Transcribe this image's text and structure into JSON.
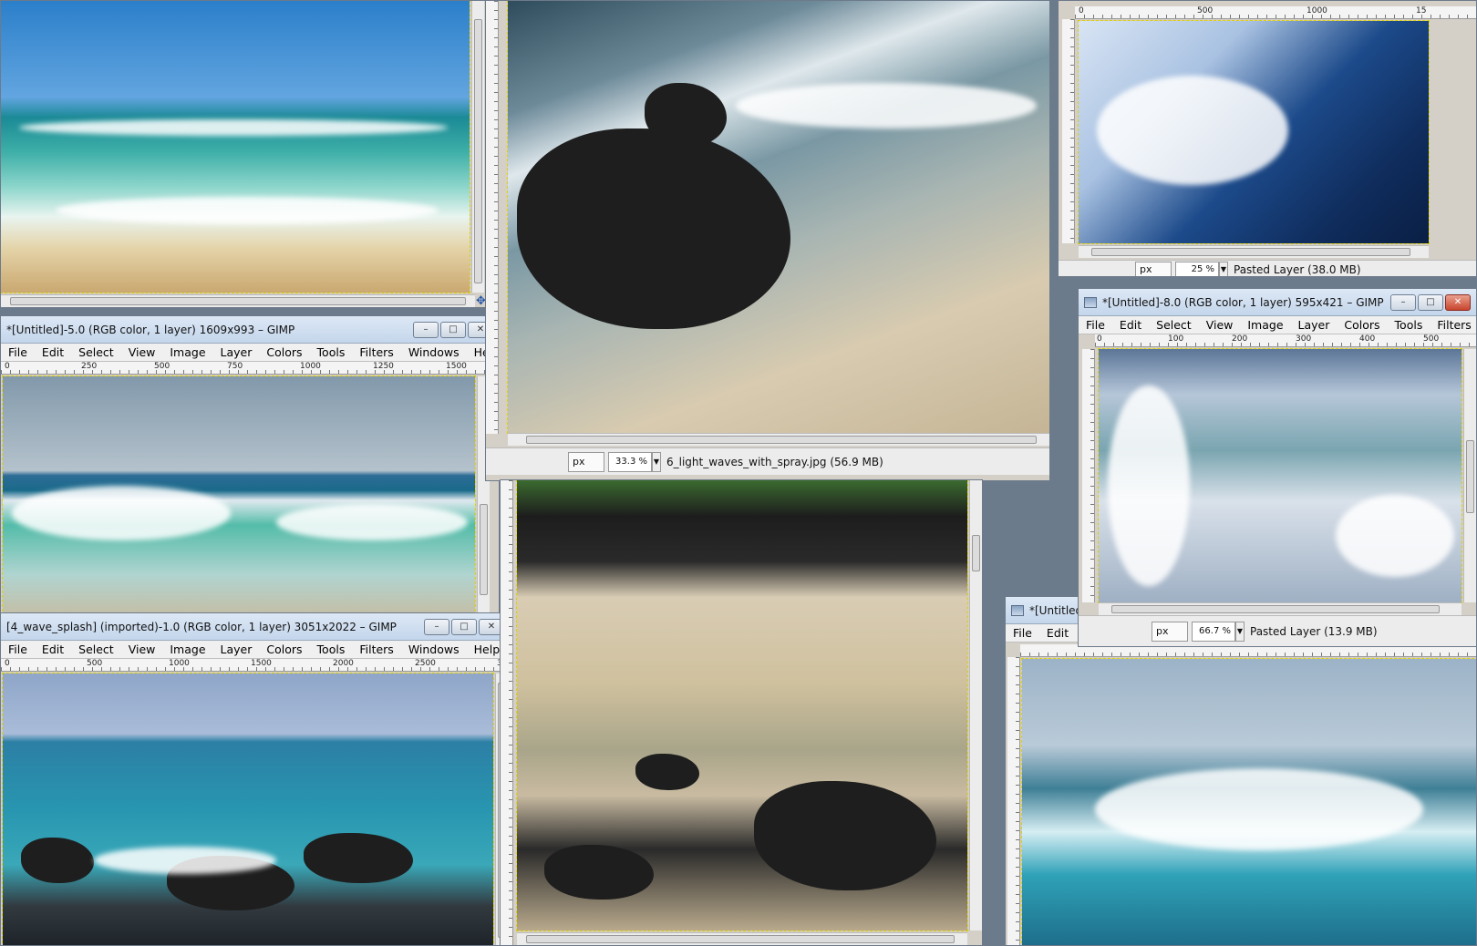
{
  "menu": [
    "File",
    "Edit",
    "Select",
    "View",
    "Image",
    "Layer",
    "Colors",
    "Tools",
    "Filters",
    "Windows",
    "Help"
  ],
  "menu_short": [
    "File",
    "Edit"
  ],
  "windows": {
    "w5": {
      "title": "*[Untitled]-5.0 (RGB color, 1 layer) 1609x993 – GIMP",
      "ruler": [
        "0",
        "250",
        "500",
        "750",
        "1000",
        "1250",
        "1500"
      ]
    },
    "w4": {
      "title": "[4_wave_splash] (imported)-1.0 (RGB color, 1 layer) 3051x2022 – GIMP",
      "ruler": [
        "0",
        "500",
        "1000",
        "1500",
        "2000",
        "2500",
        "30"
      ]
    },
    "w6": {
      "unit": "px",
      "zoom": "33.3 %",
      "status": "6_light_waves_with_spray.jpg (56.9 MB)"
    },
    "wtop": {
      "ruler": [
        "0",
        "500",
        "1000",
        "15"
      ],
      "unit": "px",
      "zoom": "25 %",
      "status": "Pasted Layer (38.0 MB)"
    },
    "w8": {
      "title": "*[Untitled]-8.0 (RGB color, 1 layer) 595x421 – GIMP",
      "ruler": [
        "0",
        "100",
        "200",
        "300",
        "400",
        "500"
      ],
      "unit": "px",
      "zoom": "66.7 %",
      "status": "Pasted Layer (13.9 MB)"
    },
    "wbr": {
      "title": "*[Untitled"
    }
  },
  "window_buttons": {
    "minimize": "–",
    "maximize": "□",
    "close": "✕"
  },
  "colors": {
    "selection": "#e0d000",
    "titlebar": "#c4d6ec",
    "close": "#c8452d"
  }
}
